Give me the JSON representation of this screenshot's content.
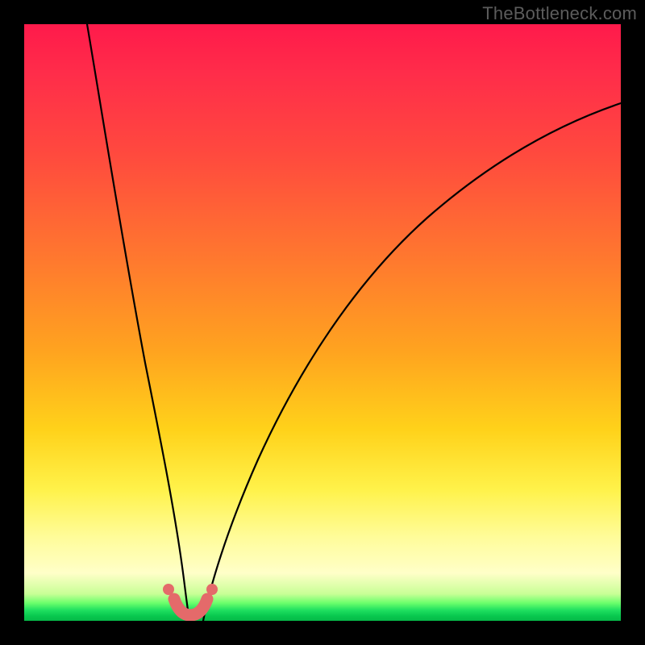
{
  "watermark": "TheBottleneck.com",
  "colors": {
    "background_frame": "#000000",
    "gradient_top": "#ff1a4b",
    "gradient_mid": "#ffd21a",
    "gradient_bottom": "#06b848",
    "curve": "#000000",
    "valley_marker": "#e46a6a"
  },
  "chart_data": {
    "type": "line",
    "title": "",
    "xlabel": "",
    "ylabel": "",
    "xlim": [
      0,
      100
    ],
    "ylim": [
      0,
      100
    ],
    "note": "Axes unlabeled; values are approximate relative positions read from the plot (0=left/bottom, 100=right/top).",
    "series": [
      {
        "name": "left-branch",
        "x": [
          10,
          12,
          14,
          16,
          18,
          20,
          22,
          24,
          25.5,
          27
        ],
        "y": [
          100,
          90,
          78,
          65,
          52,
          39,
          27,
          14,
          5,
          0
        ]
      },
      {
        "name": "right-branch",
        "x": [
          30,
          33,
          37,
          42,
          48,
          55,
          63,
          72,
          82,
          93,
          100
        ],
        "y": [
          0,
          8,
          18,
          30,
          42,
          53,
          63,
          72,
          79,
          84,
          87
        ]
      },
      {
        "name": "valley-marker",
        "x": [
          24,
          25,
          26,
          27,
          28,
          29,
          30,
          31
        ],
        "y": [
          4,
          2,
          1,
          0,
          0,
          1,
          3,
          6
        ]
      }
    ],
    "valley_minimum_x_estimate": 27.5
  }
}
